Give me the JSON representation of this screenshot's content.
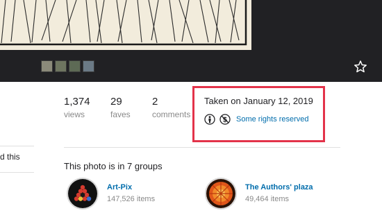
{
  "stats": [
    {
      "value": "1,374",
      "label": "views"
    },
    {
      "value": "29",
      "label": "faves"
    },
    {
      "value": "2",
      "label": "comments"
    }
  ],
  "sidebar_fragment": "d this",
  "taken_on": "Taken on January 12, 2019",
  "license": {
    "icons": [
      "attribution-icon",
      "noncommercial-icon"
    ],
    "text": "Some rights reserved"
  },
  "groups": {
    "title": "This photo is in 7 groups",
    "items": [
      {
        "name": "Art-Pix",
        "count": "147,526 items"
      },
      {
        "name": "The Authors' plaza",
        "count": "49,464 items"
      }
    ]
  },
  "colors": {
    "link": "#006dac",
    "highlight": "#e3334a",
    "viewer_bg": "#212124"
  }
}
